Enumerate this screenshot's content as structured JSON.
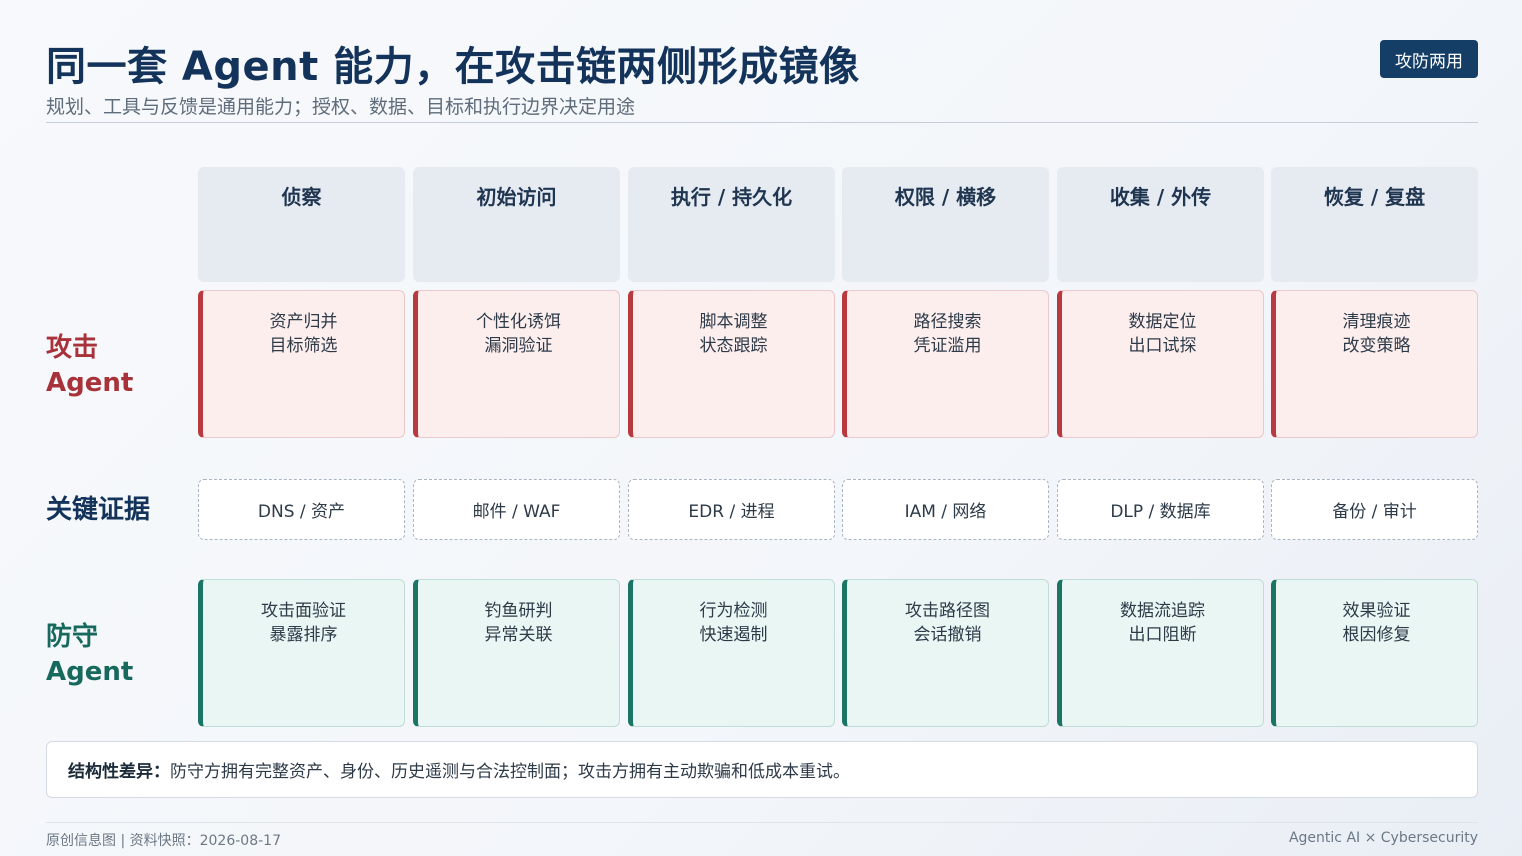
{
  "header": {
    "title": "同一套 Agent 能力，在攻击链两侧形成镜像",
    "subtitle": "规划、工具与反馈是通用能力；授权、数据、目标和执行边界决定用途",
    "tag": "攻防两用"
  },
  "rows": {
    "attack_label_1": "攻击",
    "attack_label_2": "Agent",
    "evidence_label": "关键证据",
    "defense_label_1": "防守",
    "defense_label_2": "Agent"
  },
  "columns": [
    {
      "stage": "侦察",
      "attack": [
        "资产归并",
        "目标筛选"
      ],
      "evidence": "DNS / 资产",
      "defense": [
        "攻击面验证",
        "暴露排序"
      ]
    },
    {
      "stage": "初始访问",
      "attack": [
        "个性化诱饵",
        "漏洞验证"
      ],
      "evidence": "邮件 / WAF",
      "defense": [
        "钓鱼研判",
        "异常关联"
      ]
    },
    {
      "stage": "执行 / 持久化",
      "attack": [
        "脚本调整",
        "状态跟踪"
      ],
      "evidence": "EDR / 进程",
      "defense": [
        "行为检测",
        "快速遏制"
      ]
    },
    {
      "stage": "权限 / 横移",
      "attack": [
        "路径搜索",
        "凭证滥用"
      ],
      "evidence": "IAM / 网络",
      "defense": [
        "攻击路径图",
        "会话撤销"
      ]
    },
    {
      "stage": "收集 / 外传",
      "attack": [
        "数据定位",
        "出口试探"
      ],
      "evidence": "DLP / 数据库",
      "defense": [
        "数据流追踪",
        "出口阻断"
      ]
    },
    {
      "stage": "恢复 / 复盘",
      "attack": [
        "清理痕迹",
        "改变策略"
      ],
      "evidence": "备份 / 审计",
      "defense": [
        "效果验证",
        "根因修复"
      ]
    }
  ],
  "note": {
    "label": "结构性差异：",
    "text": "防守方拥有完整资产、身份、历史遥测与合法控制面；攻击方拥有主动欺骗和低成本重试。"
  },
  "footer": {
    "left": "原创信息图 | 资料快照：2026-08-17",
    "right": "Agentic AI × Cybersecurity"
  },
  "colors": {
    "title": "#13335a",
    "attack_accent": "#b83a3f",
    "defense_accent": "#1b7565",
    "tag_bg": "#143e66"
  }
}
